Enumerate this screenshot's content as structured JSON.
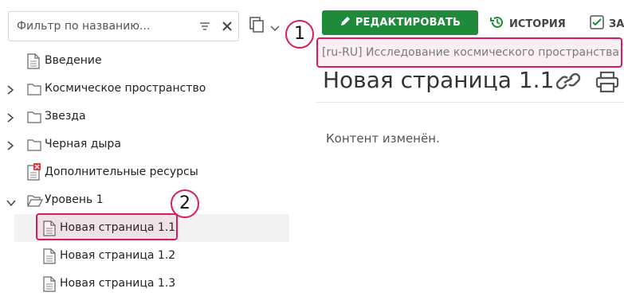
{
  "filter": {
    "placeholder": "Фильтр по названию..."
  },
  "tree": {
    "items": [
      {
        "label": "Введение",
        "expandable": false,
        "icon": "document-icon"
      },
      {
        "label": "Космическое пространство",
        "expandable": true,
        "expanded": false,
        "icon": "folder-icon"
      },
      {
        "label": "Звезда",
        "expandable": true,
        "expanded": false,
        "icon": "folder-icon"
      },
      {
        "label": "Черная дыра",
        "expandable": true,
        "expanded": false,
        "icon": "folder-icon"
      },
      {
        "label": "Дополнительные ресурсы",
        "expandable": false,
        "icon": "document-error-icon"
      },
      {
        "label": "Уровень 1",
        "expandable": true,
        "expanded": true,
        "icon": "folder-open-icon"
      },
      {
        "label": "Новая страница 1.1",
        "expandable": false,
        "icon": "document-icon",
        "selected": true
      },
      {
        "label": "Новая страница 1.2",
        "expandable": false,
        "icon": "document-icon"
      },
      {
        "label": "Новая страница 1.3",
        "expandable": false,
        "icon": "document-icon"
      }
    ]
  },
  "toolbar": {
    "edit_label": "РЕДАКТИРОВАТЬ",
    "history_label": "ИСТОРИЯ",
    "save_label": "ЗА"
  },
  "page": {
    "breadcrumb": "[ru-RU] Исследование космического пространства",
    "title": "Новая страница 1.1",
    "content": "Контент изменён."
  },
  "callouts": {
    "one": "1",
    "two": "2"
  },
  "colors": {
    "primary_green": "#1e8a3a",
    "highlight": "#d81b60",
    "error_badge": "#e53935"
  }
}
